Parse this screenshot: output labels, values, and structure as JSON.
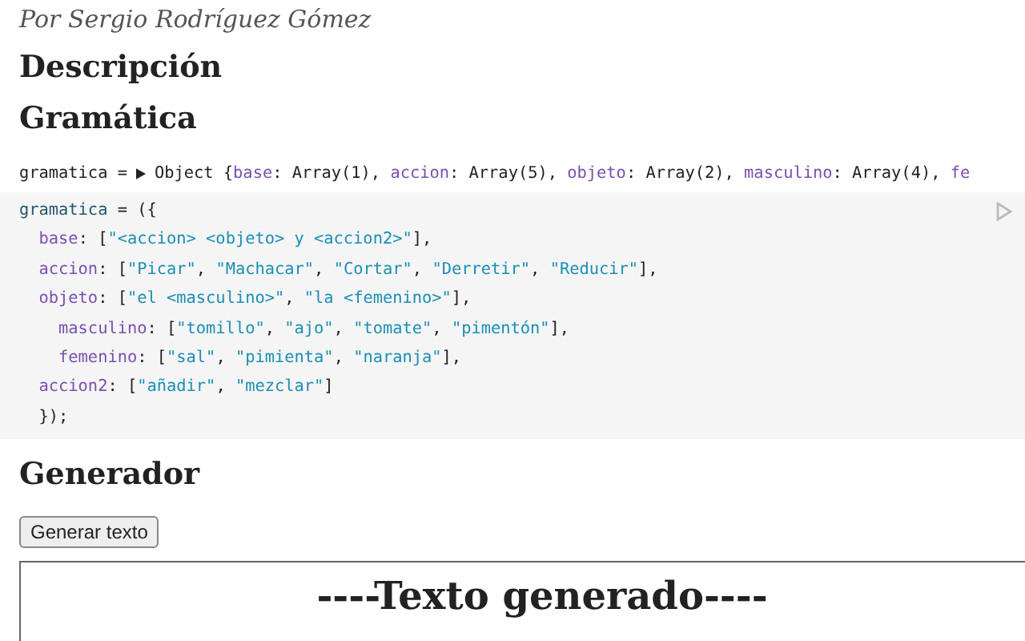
{
  "byline": "Por Sergio Rodríguez Gómez",
  "headings": [
    "Descripción",
    "Gramática"
  ],
  "inspector": {
    "name": "gramatica =",
    "expanded": false,
    "segments": [
      {
        "kind": "punct",
        "text": "Object {"
      },
      {
        "kind": "key",
        "text": "base"
      },
      {
        "kind": "punct",
        "text": ": Array(1), "
      },
      {
        "kind": "key",
        "text": "accion"
      },
      {
        "kind": "punct",
        "text": ": Array(5), "
      },
      {
        "kind": "key",
        "text": "objeto"
      },
      {
        "kind": "punct",
        "text": ": Array(2), "
      },
      {
        "kind": "key",
        "text": "masculino"
      },
      {
        "kind": "punct",
        "text": ": Array(4), "
      },
      {
        "kind": "key",
        "text": "fe"
      }
    ]
  },
  "code": [
    {
      "segments": [
        {
          "kind": "var",
          "text": "gramatica"
        },
        {
          "kind": "punct",
          "text": " = ({"
        }
      ],
      "children": [
        {
          "segments": [
            {
              "kind": "key",
              "text": "base"
            },
            {
              "kind": "punct",
              "text": ": ["
            },
            {
              "kind": "string",
              "text": "\"<accion> <objeto> y <accion2>\""
            },
            {
              "kind": "punct",
              "text": "],"
            }
          ]
        },
        {
          "segments": [
            {
              "kind": "key",
              "text": "accion"
            },
            {
              "kind": "punct",
              "text": ": ["
            },
            {
              "kind": "string",
              "text": "\"Picar\""
            },
            {
              "kind": "punct",
              "text": ", "
            },
            {
              "kind": "string",
              "text": "\"Machacar\""
            },
            {
              "kind": "punct",
              "text": ", "
            },
            {
              "kind": "string",
              "text": "\"Cortar\""
            },
            {
              "kind": "punct",
              "text": ", "
            },
            {
              "kind": "string",
              "text": "\"Derretir\""
            },
            {
              "kind": "punct",
              "text": ", "
            },
            {
              "kind": "string",
              "text": "\"Reducir\""
            },
            {
              "kind": "punct",
              "text": "],"
            }
          ]
        },
        {
          "segments": [
            {
              "kind": "key",
              "text": "objeto"
            },
            {
              "kind": "punct",
              "text": ": ["
            },
            {
              "kind": "string",
              "text": "\"el <masculino>\""
            },
            {
              "kind": "punct",
              "text": ", "
            },
            {
              "kind": "string",
              "text": "\"la <femenino>\""
            },
            {
              "kind": "punct",
              "text": "],"
            }
          ],
          "children": [
            {
              "segments": [
                {
                  "kind": "key",
                  "text": "masculino"
                },
                {
                  "kind": "punct",
                  "text": ": ["
                },
                {
                  "kind": "string",
                  "text": "\"tomillo\""
                },
                {
                  "kind": "punct",
                  "text": ", "
                },
                {
                  "kind": "string",
                  "text": "\"ajo\""
                },
                {
                  "kind": "punct",
                  "text": ", "
                },
                {
                  "kind": "string",
                  "text": "\"tomate\""
                },
                {
                  "kind": "punct",
                  "text": ", "
                },
                {
                  "kind": "string",
                  "text": "\"pimentón\""
                },
                {
                  "kind": "punct",
                  "text": "],"
                }
              ]
            },
            {
              "segments": [
                {
                  "kind": "key",
                  "text": "femenino"
                },
                {
                  "kind": "punct",
                  "text": ": ["
                },
                {
                  "kind": "string",
                  "text": "\"sal\""
                },
                {
                  "kind": "punct",
                  "text": ", "
                },
                {
                  "kind": "string",
                  "text": "\"pimienta\""
                },
                {
                  "kind": "punct",
                  "text": ", "
                },
                {
                  "kind": "string",
                  "text": "\"naranja\""
                },
                {
                  "kind": "punct",
                  "text": "],"
                }
              ]
            }
          ]
        },
        {
          "segments": [
            {
              "kind": "key",
              "text": "accion2"
            },
            {
              "kind": "punct",
              "text": ": ["
            },
            {
              "kind": "string",
              "text": "\"añadir\""
            },
            {
              "kind": "punct",
              "text": ", "
            },
            {
              "kind": "string",
              "text": "\"mezclar\""
            },
            {
              "kind": "punct",
              "text": "]"
            }
          ]
        },
        {
          "segments": [
            {
              "kind": "punct",
              "text": "});"
            }
          ]
        }
      ]
    }
  ],
  "generator": {
    "heading": "Generador",
    "button": "Generar texto",
    "output_title": "----Texto generado----"
  }
}
